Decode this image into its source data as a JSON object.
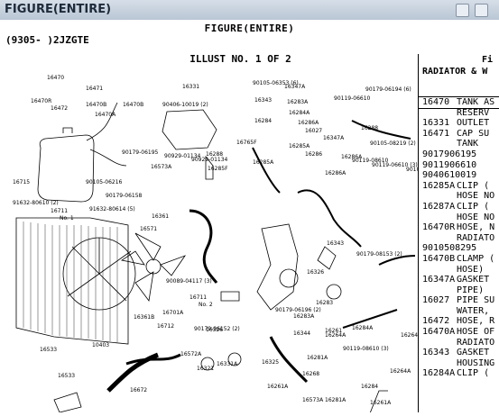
{
  "window": {
    "title": "FIGURE(ENTIRE)"
  },
  "header": {
    "figure_title": "FIGURE(ENTIRE)",
    "model_range": "(9305-      )2JZGTE",
    "illust": "ILLUST NO. 1 OF 2"
  },
  "sidebar": {
    "head_frag": "Fi",
    "head_title": "RADIATOR & W",
    "rows": [
      {
        "code": "16470",
        "desc": "TANK AS"
      },
      {
        "code": "",
        "desc": "RESERV"
      },
      {
        "code": "16331",
        "desc": "OUTLET"
      },
      {
        "code": "16471",
        "desc": "CAP SU"
      },
      {
        "code": "",
        "desc": "TANK"
      },
      {
        "code": "9017906195",
        "desc": ""
      },
      {
        "code": "9011906610",
        "desc": ""
      },
      {
        "code": "9040610019",
        "desc": ""
      },
      {
        "code": "16285A",
        "desc": "CLIP ("
      },
      {
        "code": "",
        "desc": "HOSE NO"
      },
      {
        "code": "16287A",
        "desc": "CLIP ("
      },
      {
        "code": "",
        "desc": "HOSE NO"
      },
      {
        "code": "16470R",
        "desc": "HOSE, N"
      },
      {
        "code": "",
        "desc": "RADIATO"
      },
      {
        "code": "9010508295",
        "desc": ""
      },
      {
        "code": "16470B",
        "desc": "CLAMP ("
      },
      {
        "code": "",
        "desc": "HOSE)"
      },
      {
        "code": "16347A",
        "desc": "GASKET"
      },
      {
        "code": "",
        "desc": "PIPE)"
      },
      {
        "code": "16027",
        "desc": "PIPE SU"
      },
      {
        "code": "",
        "desc": "WATER,"
      },
      {
        "code": "16472",
        "desc": "HOSE, R"
      },
      {
        "code": "16470A",
        "desc": "HOSE OF"
      },
      {
        "code": "",
        "desc": "RADIATO"
      },
      {
        "code": "16343",
        "desc": "GASKET"
      },
      {
        "code": "",
        "desc": "HOUSING"
      },
      {
        "code": "16284A",
        "desc": "CLIP ("
      }
    ]
  },
  "diagram": {
    "labels": [
      "16470",
      "16471",
      "16470R",
      "16472",
      "16470B",
      "16470B",
      "16470A",
      "16331",
      "90105-06353 (6)",
      "16347A",
      "90179-06194 (6)",
      "16343",
      "16283A",
      "16284A",
      "16284",
      "16286A",
      "16027",
      "90119-06610",
      "90105-08219 (2)",
      "16347A",
      "16765F",
      "16288",
      "16285A",
      "16286",
      "16286A",
      "90929-01134",
      "90179-06195",
      "16288",
      "16285A",
      "16286A",
      "90105-08219",
      "90119-06610 (3)",
      "90929-01134",
      "16285F",
      "90406-10019 (2)",
      "16573A",
      "90119-08610",
      "16715",
      "90105-06216",
      "90179-06158",
      "91632-80610 (2)",
      "91632-80614 (5)",
      "16711",
      "No. 1",
      "16361",
      "16571",
      "90179-08153 (2)",
      "16343",
      "16326",
      "16344",
      "90089-04117 (3)",
      "16711",
      "No. 2",
      "16701A",
      "16361B",
      "16712",
      "90179-06152 (2)",
      "16326",
      "16283A",
      "90179-06196 (2)",
      "16283",
      "16261",
      "10403",
      "16533",
      "16572A",
      "16321",
      "16331A",
      "16325",
      "16281A",
      "16284A",
      "16264A",
      "90119-08610 (3)",
      "16268",
      "16284",
      "16261A",
      "16672",
      "16573A",
      "16261A",
      "16264A",
      "16281A",
      "16533",
      "16264A"
    ]
  }
}
